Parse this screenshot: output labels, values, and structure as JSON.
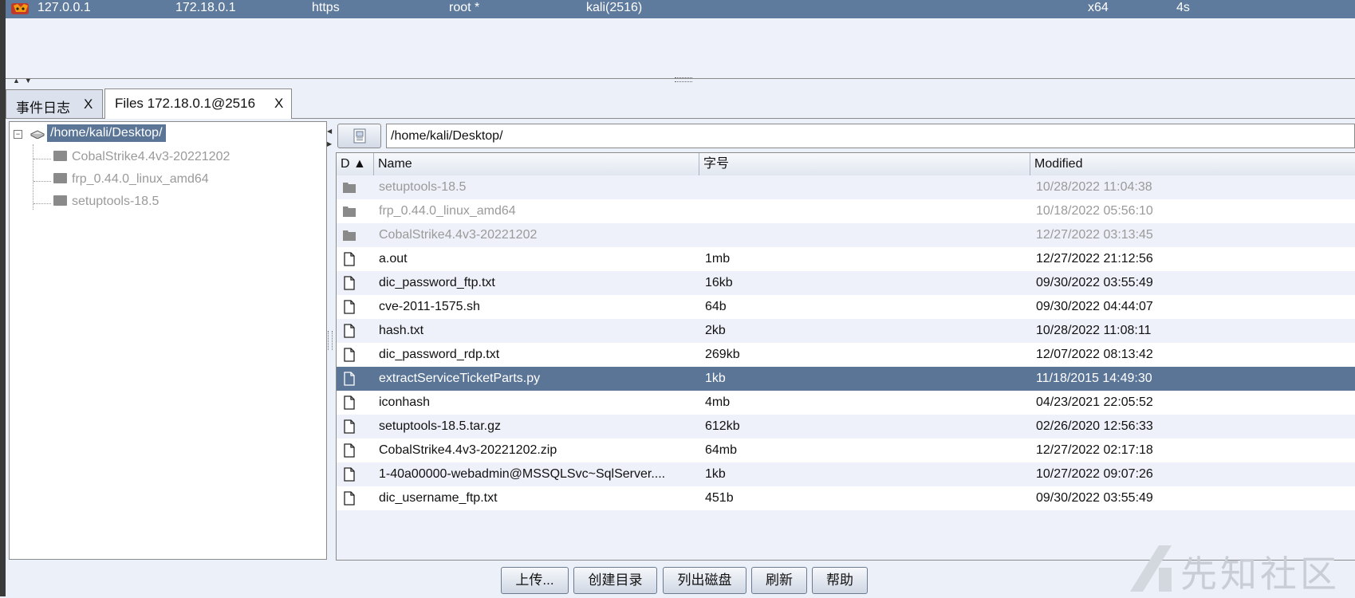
{
  "session": {
    "external_ip": "127.0.0.1",
    "internal_ip": "172.18.0.1",
    "listener": "https",
    "user": "root *",
    "process": "kali(2516)",
    "arch": "x64",
    "last": "4s"
  },
  "tabs": [
    {
      "label": "事件日志",
      "close": "X"
    },
    {
      "label": "Files 172.18.0.1@2516",
      "close": "X"
    }
  ],
  "tree": {
    "root": "/home/kali/Desktop/",
    "children": [
      "CobalStrike4.4v3-20221202",
      "frp_0.44.0_linux_amd64",
      "setuptools-18.5"
    ]
  },
  "path_bar": {
    "value": "/home/kali/Desktop/"
  },
  "columns": {
    "d": "D ▲",
    "name": "Name",
    "size": "字号",
    "modified": "Modified"
  },
  "rows": [
    {
      "type": "dir",
      "name": "setuptools-18.5",
      "size": "",
      "modified": "10/28/2022 11:04:38"
    },
    {
      "type": "dir",
      "name": "frp_0.44.0_linux_amd64",
      "size": "",
      "modified": "10/18/2022 05:56:10"
    },
    {
      "type": "dir",
      "name": "CobalStrike4.4v3-20221202",
      "size": "",
      "modified": "12/27/2022 03:13:45"
    },
    {
      "type": "file",
      "name": "a.out",
      "size": "1mb",
      "modified": "12/27/2022 21:12:56"
    },
    {
      "type": "file",
      "name": "dic_password_ftp.txt",
      "size": "16kb",
      "modified": "09/30/2022 03:55:49"
    },
    {
      "type": "file",
      "name": "cve-2011-1575.sh",
      "size": "64b",
      "modified": "09/30/2022 04:44:07"
    },
    {
      "type": "file",
      "name": "hash.txt",
      "size": "2kb",
      "modified": "10/28/2022 11:08:11"
    },
    {
      "type": "file",
      "name": "dic_password_rdp.txt",
      "size": "269kb",
      "modified": "12/07/2022 08:13:42"
    },
    {
      "type": "file",
      "name": "extractServiceTicketParts.py",
      "size": "1kb",
      "modified": "11/18/2015 14:49:30",
      "selected": true
    },
    {
      "type": "file",
      "name": "iconhash",
      "size": "4mb",
      "modified": "04/23/2021 22:05:52"
    },
    {
      "type": "file",
      "name": "setuptools-18.5.tar.gz",
      "size": "612kb",
      "modified": "02/26/2020 12:56:33"
    },
    {
      "type": "file",
      "name": "CobalStrike4.4v3-20221202.zip",
      "size": "64mb",
      "modified": "12/27/2022 02:17:18"
    },
    {
      "type": "file",
      "name": "1-40a00000-webadmin@MSSQLSvc~SqlServer....",
      "size": "1kb",
      "modified": "10/27/2022 09:07:26"
    },
    {
      "type": "file",
      "name": "dic_username_ftp.txt",
      "size": "451b",
      "modified": "09/30/2022 03:55:49"
    }
  ],
  "buttons": {
    "upload": "上传...",
    "mkdir": "创建目录",
    "list_drives": "列出磁盘",
    "refresh": "刷新",
    "help": "帮助"
  },
  "watermark": "先知社区",
  "colors": {
    "session_bar": "#5e7a9c",
    "selection": "#5b7597",
    "background": "#ecf0f8"
  }
}
